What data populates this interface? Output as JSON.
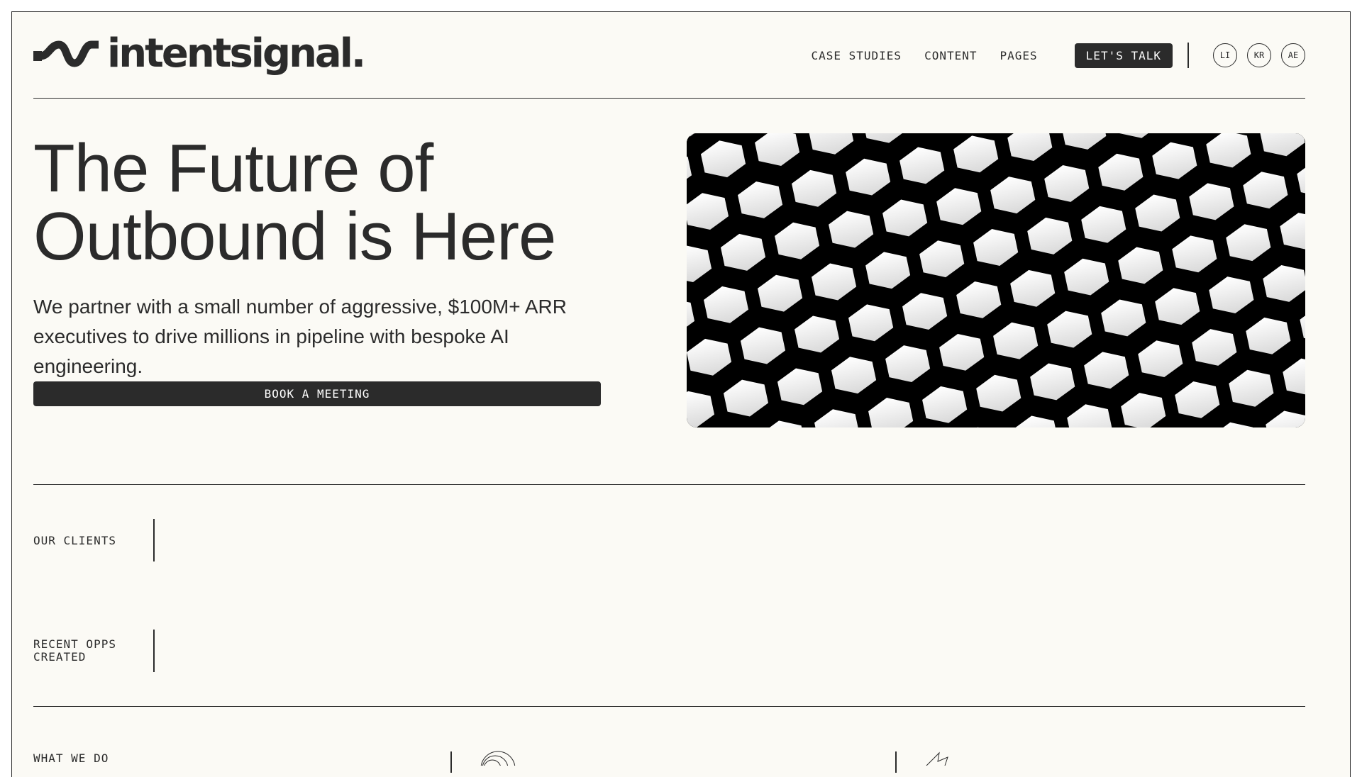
{
  "brand": {
    "name": "intentsignal."
  },
  "nav": {
    "links": [
      "CASE STUDIES",
      "CONTENT",
      "PAGES"
    ],
    "cta_label": "LET'S TALK",
    "avatars": [
      "LI",
      "KR",
      "AE"
    ]
  },
  "hero": {
    "title_line1": "The Future of",
    "title_line2": "Outbound is Here",
    "subtitle": "We partner with a small number of aggressive, $100M+ ARR executives to drive millions in pipeline with bespoke AI engineering.",
    "button_label": "BOOK A MEETING"
  },
  "sections": {
    "clients_label": "OUR CLIENTS",
    "opps_label_line1": "RECENT OPPS",
    "opps_label_line2": "CREATED",
    "what_we_do_label": "WHAT WE DO"
  },
  "colors": {
    "ink": "#2b2b2b",
    "paper": "#fbfaf5",
    "button_text": "#ffffff"
  }
}
